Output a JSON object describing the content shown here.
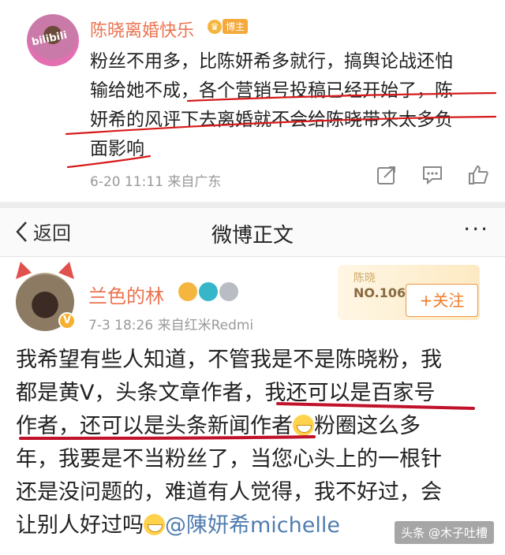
{
  "post1": {
    "author": "陈晓离婚快乐",
    "badge_label": "博主",
    "lines": [
      "粉丝不用多，比陈妍希多就行，搞舆论战还怕",
      "输给她不成，各个营销号投稿已经开始了，陈",
      "妍希的风评下去离婚就不会给陈晓带来太多负",
      "面影响"
    ],
    "meta": "6-20 11:11 来自广东",
    "actions": [
      "share-icon",
      "comment-icon",
      "like-icon"
    ]
  },
  "navbar": {
    "back_label": "返回",
    "title": "微博正文",
    "more_label": "···"
  },
  "post2": {
    "author": "兰色的林",
    "meta": "7-3 18:26 来自红米Redmi",
    "fan_card": {
      "name": "陈晓",
      "number": "NO.10600"
    },
    "follow_label": "+关注",
    "lines": [
      "我希望有些人知道，不管我是不是陈晓粉，我",
      "都是黄V，头条文章作者，我还可以是百家号",
      "作者，还可以是头条新闻作者",
      "粉圈这么多",
      "年，我要是不当粉丝了，当您心头上的一根针",
      "还是没问题的，难道有人觉得，我不好过，会",
      "让别人好过吗",
      "@陳妍希michelle"
    ]
  },
  "watermark": "头条 @木子吐槽",
  "colors": {
    "author": "#eb7350",
    "link": "#507daf",
    "annotation": "#d61a1a",
    "follow": "#f07b29"
  }
}
